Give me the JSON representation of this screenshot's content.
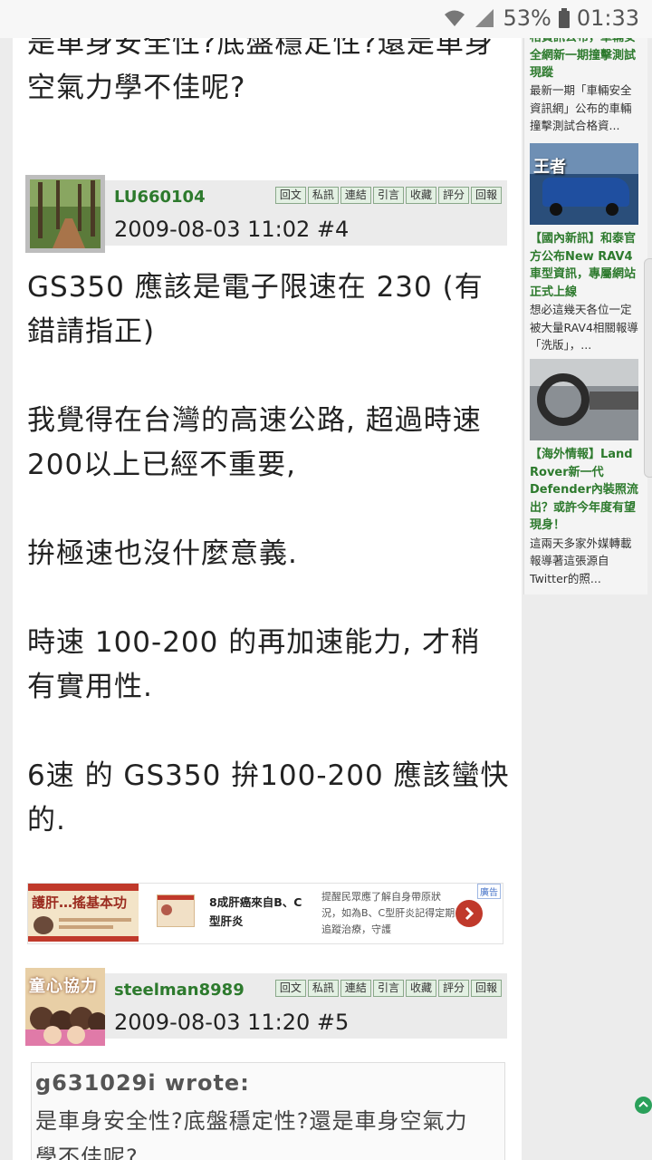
{
  "status_bar": {
    "battery": "53%",
    "time": "01:33"
  },
  "post3": {
    "text_line1": "是車身安全性?底盤穩定性?還是車身",
    "text_line2": "空氣力學不佳呢?"
  },
  "post4": {
    "username": "LU660104",
    "timestamp": "2009-08-03 11:02  #4",
    "actions": [
      "回文",
      "私訊",
      "連結",
      "引言",
      "收藏",
      "評分",
      "回報"
    ],
    "lines": [
      "GS350 應該是電子限速在 230 (有",
      "錯請指正)",
      "我覺得在台灣的高速公路, 超過時速",
      "200以上已經不重要,",
      "拚極速也沒什麼意義.",
      "時速 100-200 的再加速能力, 才稍",
      "有實用性.",
      "6速 的 GS350 拚100-200 應該蠻快",
      "的."
    ]
  },
  "ad": {
    "badge": "廣告",
    "brand": "護肝…搖基本功",
    "headline": "8成肝癌來自B、C型肝炎",
    "body": "提醒民眾應了解自身帶原狀況，如為B、C型肝炎記得定期追蹤治療，守護"
  },
  "post5": {
    "avatar_text": "童心協力",
    "username": "steelman8989",
    "timestamp": "2009-08-03 11:20  #5",
    "actions": [
      "回文",
      "私訊",
      "連結",
      "引言",
      "收藏",
      "評分",
      "回報"
    ],
    "quote_author": "g631029i wrote:",
    "quote_text": "是車身安全性?底盤穩定性?還是車身空氣力",
    "quote_text2": "學不佳呢?"
  },
  "sidebar": {
    "card1": {
      "title": "格資訊公布，車輛安全網新一期撞擊測試現蹤",
      "desc": "最新一期「車輛安全資訊網」公布的車輛撞擊測試合格資..."
    },
    "card2": {
      "image_text": "王者",
      "title": "【國內新訊】和泰官方公布New RAV4車型資訊，專屬網站正式上線",
      "desc": "想必這幾天各位一定被大量RAV4相關報導「洗版」，..."
    },
    "card3": {
      "title": "【海外情報】Land Rover新一代Defender內裝照流出？或許今年度有望現身！",
      "desc": "這兩天多家外媒轉載報導著這張源自Twitter的照..."
    }
  }
}
